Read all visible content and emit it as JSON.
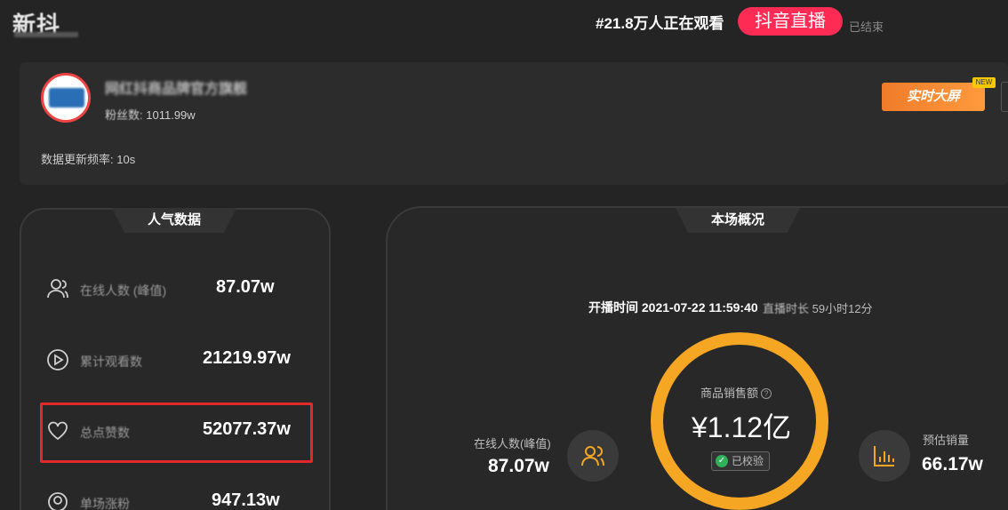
{
  "brand": {
    "logo_text": "新抖"
  },
  "live_status": {
    "viewers_text": "#21.8万人正在观看",
    "platform_badge": "抖音直播",
    "status": "已结束"
  },
  "streamer": {
    "name": "网红抖商品牌官方旗舰",
    "fans_label": "粉丝数:",
    "fans_value": "1011.99w",
    "update_freq_label": "数据更新频率:",
    "update_freq_value": "10s",
    "realtime_button": "实时大屏",
    "new_tag": "NEW"
  },
  "popularity": {
    "title": "人气数据",
    "rows": [
      {
        "label": "在线人数 (峰值)",
        "value": "87.07w",
        "icon": "user-icon"
      },
      {
        "label": "累计观看数",
        "value": "21219.97w",
        "icon": "play-icon"
      },
      {
        "label": "总点赞数",
        "value": "52077.37w",
        "icon": "heart-icon"
      },
      {
        "label": "单场涨粉",
        "value": "947.13w",
        "icon": "fans-icon"
      }
    ]
  },
  "overview": {
    "title": "本场概况",
    "start_time_label": "开播时间",
    "start_time_value": "2021-07-22 11:59:40",
    "duration_label": "直播时长",
    "duration_value": "59小时12分",
    "sales_label": "商品销售额",
    "sales_value": "¥1.12亿",
    "verified": "已校验",
    "online_label": "在线人数(峰值)",
    "online_value": "87.07w",
    "est_sales_label": "预估销量",
    "est_sales_value": "66.17w"
  },
  "colors": {
    "accent_ring": "#f5a623",
    "live_badge": "#fe2c55",
    "highlight": "#e02a2a",
    "button_orange": "#f07c2a"
  }
}
